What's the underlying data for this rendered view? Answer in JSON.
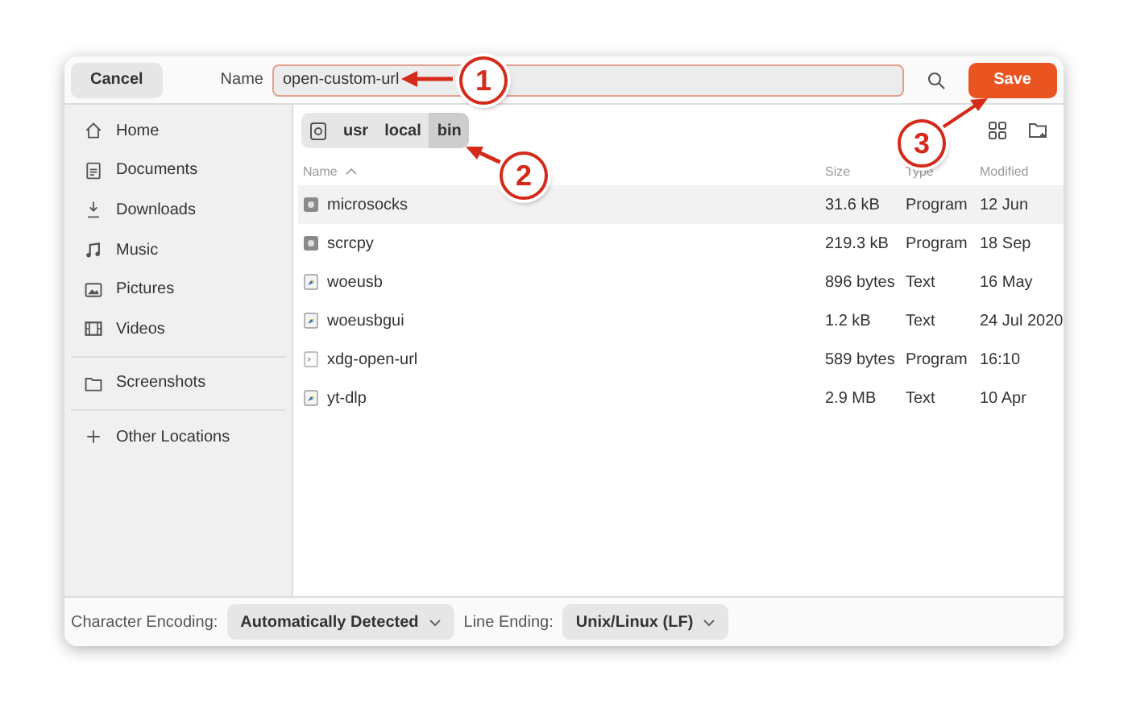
{
  "header": {
    "cancel": "Cancel",
    "name_label": "Name",
    "name_value": "open-custom-url",
    "save": "Save"
  },
  "sidebar": {
    "sections": [
      [
        {
          "label": "Home"
        },
        {
          "label": "Documents"
        },
        {
          "label": "Downloads"
        },
        {
          "label": "Music"
        },
        {
          "label": "Pictures"
        },
        {
          "label": "Videos"
        }
      ],
      [
        {
          "label": "Screenshots"
        }
      ],
      [
        {
          "label": "Other Locations"
        }
      ]
    ]
  },
  "pathbar": [
    {
      "kind": "root",
      "selected": false
    },
    {
      "label": "usr",
      "kind": "folder",
      "selected": false
    },
    {
      "label": "local",
      "kind": "folder",
      "selected": false
    },
    {
      "label": "bin",
      "kind": "folder",
      "selected": true
    }
  ],
  "table": {
    "columns": [
      "Name",
      "Size",
      "Type",
      "Modified"
    ],
    "rows": [
      {
        "name": "microsocks",
        "kind": "executable",
        "size": "31.6 kB",
        "type": "Program",
        "modified": "12 Jun",
        "selected": true
      },
      {
        "name": "scrcpy",
        "kind": "executable",
        "size": "219.3 kB",
        "type": "Program",
        "modified": "18 Sep",
        "selected": false
      },
      {
        "name": "woeusb",
        "kind": "script",
        "size": "896 bytes",
        "type": "Text",
        "modified": "16 May",
        "selected": false
      },
      {
        "name": "woeusbgui",
        "kind": "script",
        "size": "1.2 kB",
        "type": "Text",
        "modified": "24 Jul 2020",
        "selected": false
      },
      {
        "name": "xdg-open-url",
        "kind": "shell",
        "size": "589 bytes",
        "type": "Program",
        "modified": "16:10",
        "selected": false
      },
      {
        "name": "yt-dlp",
        "kind": "script",
        "size": "2.9 MB",
        "type": "Text",
        "modified": "10 Apr",
        "selected": false
      }
    ]
  },
  "footer": {
    "encoding_label": "Character Encoding:",
    "encoding_value": "Automatically Detected",
    "line_ending_label": "Line Ending:",
    "line_ending_value": "Unix/Linux (LF)"
  },
  "callouts": [
    {
      "label": "1"
    },
    {
      "label": "2"
    },
    {
      "label": "3"
    }
  ]
}
